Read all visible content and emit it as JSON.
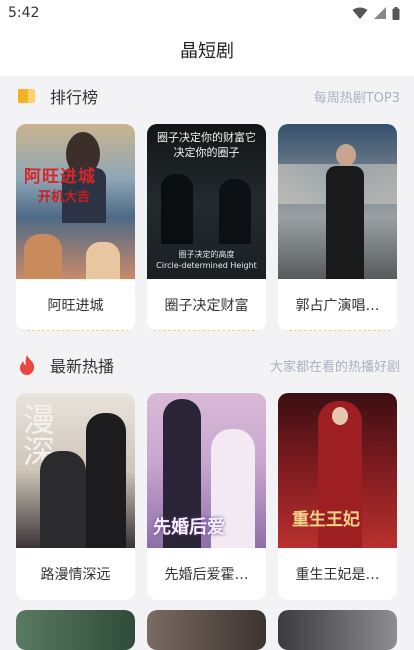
{
  "status_bar": {
    "time": "5:42"
  },
  "app": {
    "title": "晶短剧"
  },
  "ranking": {
    "title": "排行榜",
    "subtitle": "每周热剧TOP3",
    "cards": [
      {
        "label": "阿旺进城",
        "poster_text": "阿旺进城",
        "poster_subtext": "开机大吉"
      },
      {
        "label": "圈子决定财富",
        "poster_text": "圈子决定你的财富它决定你的圈子",
        "poster_caption_1": "圈子决定的高度",
        "poster_caption_2": "Circle-determined Height"
      },
      {
        "label": "郭占广演唱…"
      }
    ]
  },
  "latest": {
    "title": "最新热播",
    "subtitle": "大家都在看的热播好剧",
    "cards": [
      {
        "label": "路漫情深远",
        "poster_text": "漫深"
      },
      {
        "label": "先婚后爱霍…",
        "poster_text": "先婚后爱"
      },
      {
        "label": "重生王妃是…",
        "poster_text": "重生王妃"
      }
    ]
  }
}
